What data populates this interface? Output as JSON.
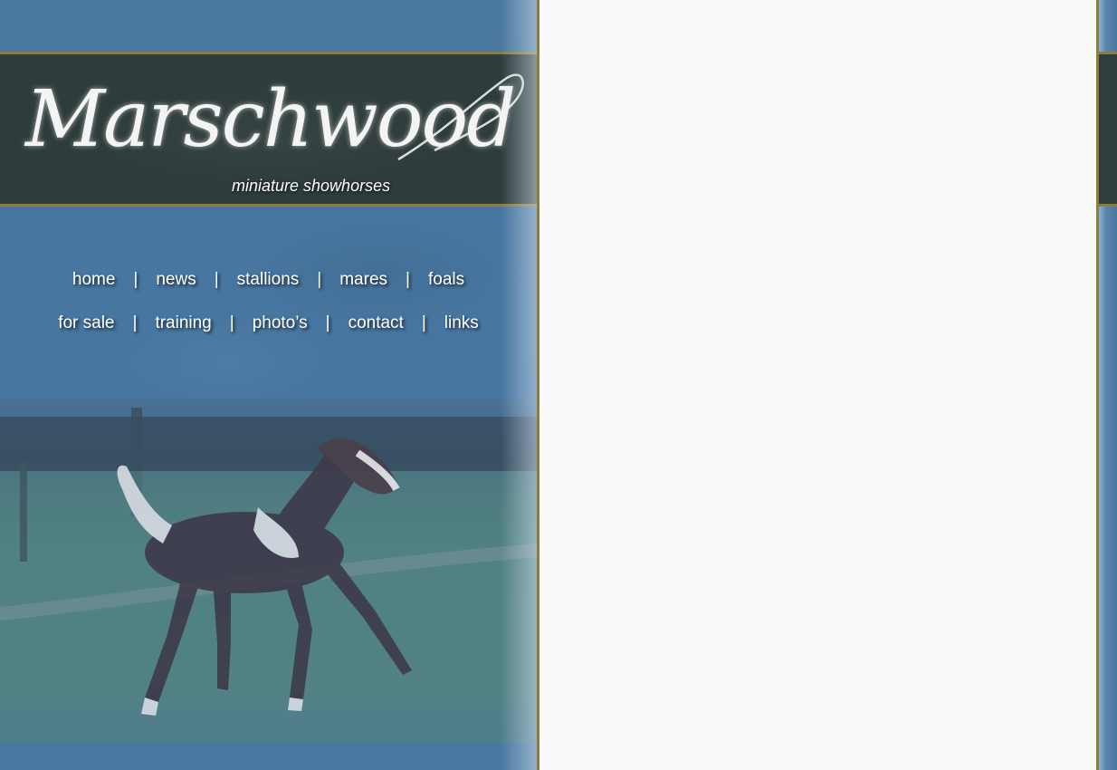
{
  "brand": {
    "title": "Marschwood",
    "subtitle": "miniature showhorses"
  },
  "nav": {
    "separator": "|",
    "row1": [
      "home",
      "news",
      "stallions",
      "mares",
      "foals"
    ],
    "row2": [
      "for sale",
      "training",
      "photo’s",
      "contact",
      "links"
    ]
  },
  "colors": {
    "background_blue": "#4a77a0",
    "banner_dark": "#2e3c3b",
    "gold_border": "#8d7c3c",
    "content_bg": "#fafafa"
  },
  "photo": {
    "subject": "foal-photo"
  }
}
